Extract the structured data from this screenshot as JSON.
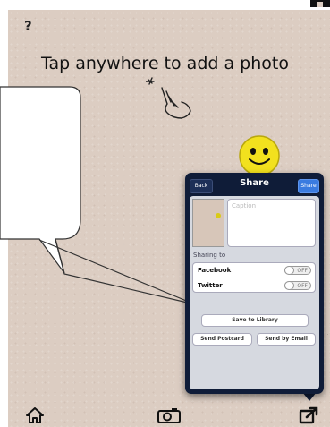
{
  "app": {
    "help_label": "?",
    "instruction": "Tap anywhere to add a photo"
  },
  "share_popover": {
    "back_label": "Back",
    "title": "Share",
    "share_label": "Share",
    "caption_placeholder": "Caption",
    "section_label": "Sharing to",
    "services": [
      {
        "label": "Facebook",
        "state": "OFF"
      },
      {
        "label": "Twitter",
        "state": "OFF"
      }
    ],
    "save_label": "Save to Library",
    "postcard_label": "Send Postcard",
    "email_label": "Send by Email"
  },
  "toolbar": {
    "icons": [
      "home-icon",
      "camera-icon",
      "share-icon"
    ]
  },
  "colors": {
    "background": "#dccdc2",
    "popover": "#0f1c38",
    "accent": "#3a7be0",
    "smiley": "#f2e11e"
  }
}
